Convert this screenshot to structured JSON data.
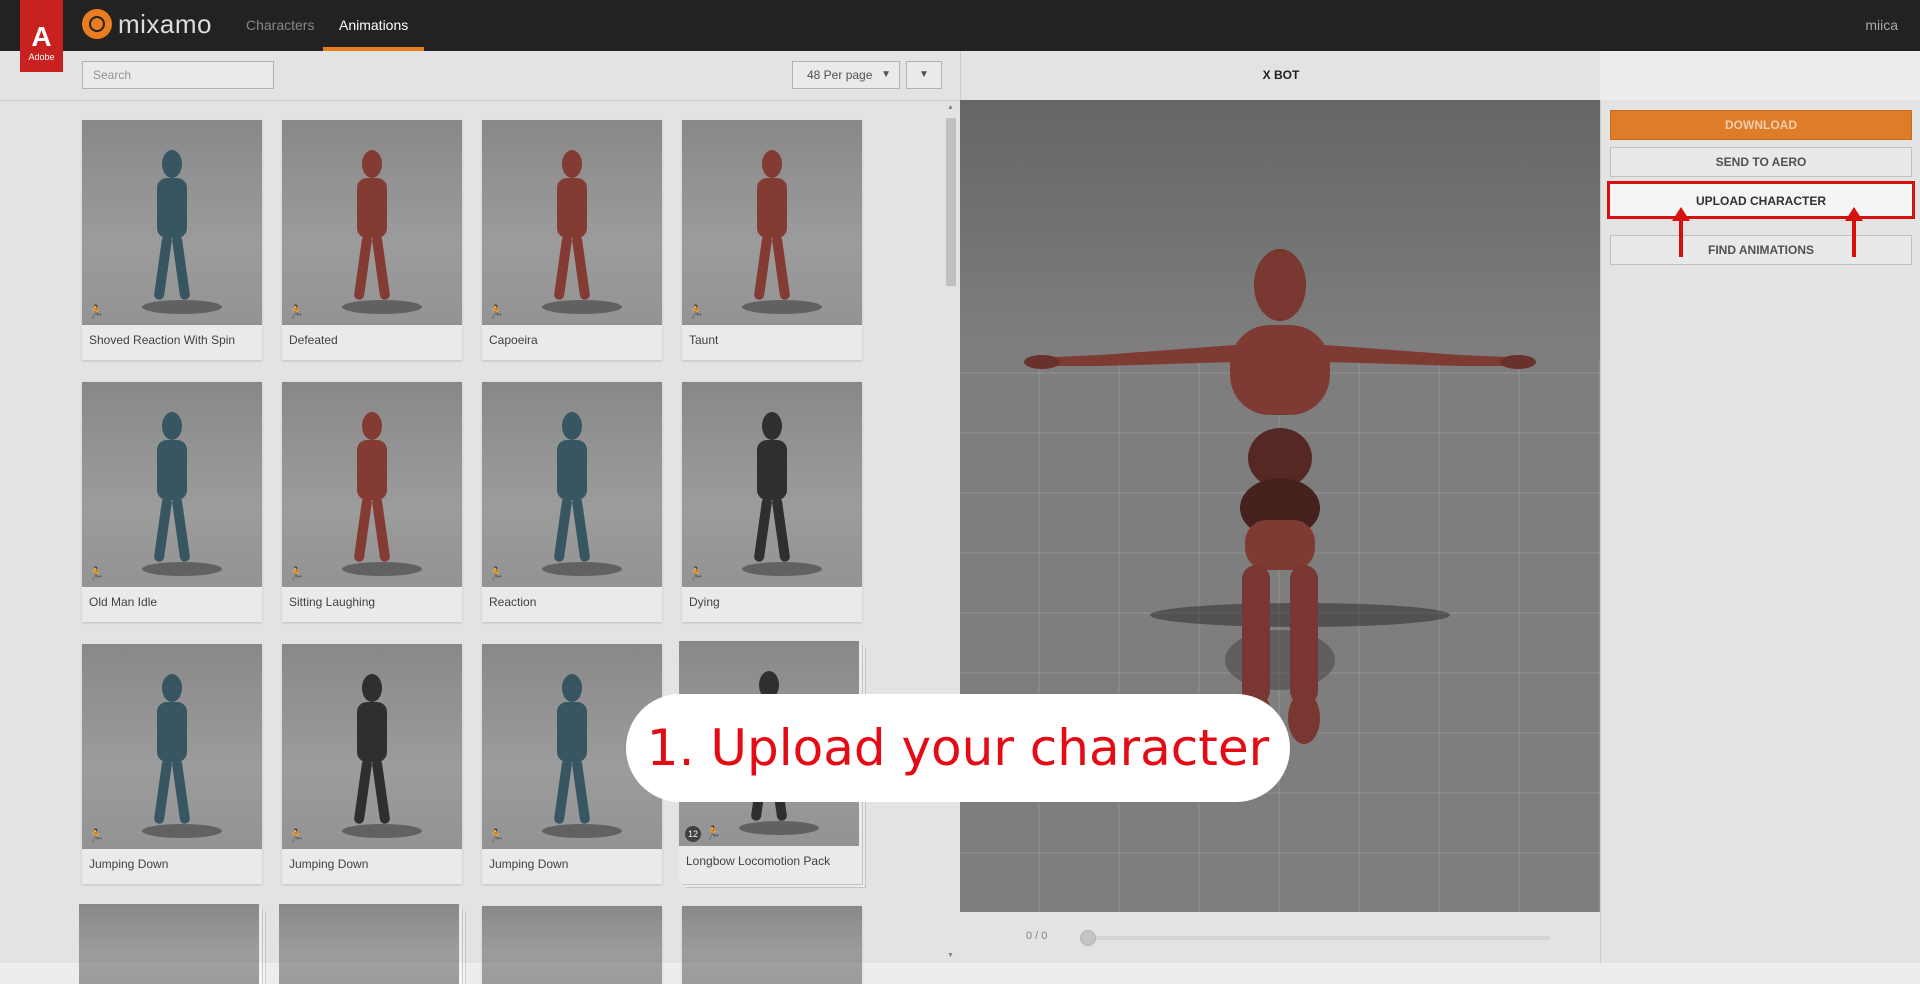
{
  "adobe": {
    "label": "Adobe"
  },
  "brand": {
    "name": "mixamo",
    "accent": "#e87e20"
  },
  "nav": {
    "tabs": [
      {
        "label": "Characters"
      },
      {
        "label": "Animations"
      }
    ],
    "active": "Animations"
  },
  "user": {
    "name": "miica"
  },
  "search": {
    "placeholder": "Search"
  },
  "per_page": {
    "selected": "48 Per page"
  },
  "animations": [
    {
      "name": "Shoved Reaction With Spin",
      "tone": "teal"
    },
    {
      "name": "Defeated",
      "tone": "red"
    },
    {
      "name": "Capoeira",
      "tone": "red"
    },
    {
      "name": "Taunt",
      "tone": "red"
    },
    {
      "name": "Old Man Idle",
      "tone": "teal"
    },
    {
      "name": "Sitting Laughing",
      "tone": "red"
    },
    {
      "name": "Reaction",
      "tone": "teal"
    },
    {
      "name": "Dying",
      "tone": "dark"
    },
    {
      "name": "Jumping Down",
      "tone": "teal"
    },
    {
      "name": "Jumping Down",
      "tone": "dark"
    },
    {
      "name": "Jumping Down",
      "tone": "teal"
    },
    {
      "name": "Longbow Locomotion Pack",
      "tone": "dark",
      "pack_count": "12"
    }
  ],
  "viewer": {
    "character": "X BOT",
    "time": "0 / 0"
  },
  "actions": {
    "download": "DOWNLOAD",
    "send_to_aero": "SEND TO AERO",
    "upload_character": "UPLOAD CHARACTER",
    "find_animations": "FIND ANIMATIONS"
  },
  "callout": {
    "text": "1. Upload your character",
    "color": "#e50b14"
  }
}
